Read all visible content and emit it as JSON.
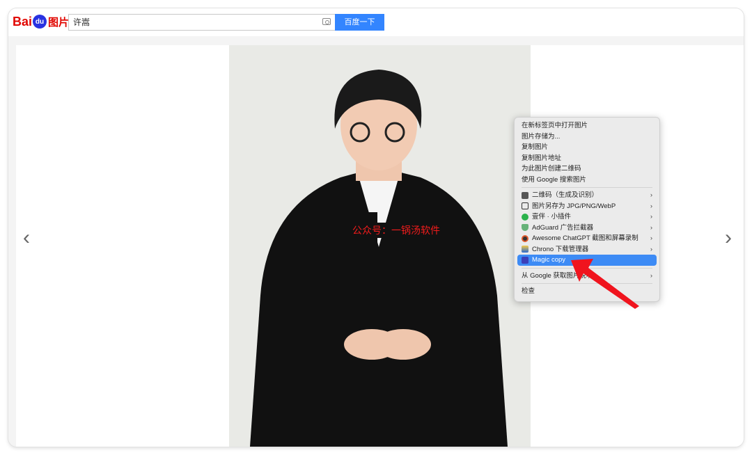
{
  "header": {
    "logo_text": "Bai du 图片",
    "search_value": "许嵩",
    "search_button": "百度一下"
  },
  "viewer": {
    "prev_icon": "chevron-left",
    "next_icon": "chevron-right",
    "watermark": "公众号：一锅汤软件"
  },
  "context_menu": {
    "group1": [
      "在新标签页中打开图片",
      "图片存储为...",
      "复制图片",
      "复制图片地址",
      "为此图片创建二维码",
      "使用 Google 搜索图片"
    ],
    "group2": [
      {
        "label": "二维码（生成及识别）",
        "icon": "qr-icon",
        "color": "#555555"
      },
      {
        "label": "图片另存为 JPG/PNG/WebP",
        "icon": "image-icon",
        "color": "#333333"
      },
      {
        "label": "壹伴 · 小插件",
        "icon": "yiban-icon",
        "color": "#2bb24c"
      },
      {
        "label": "AdGuard 广告拦截器",
        "icon": "shield-icon",
        "color": "#67b279"
      },
      {
        "label": "Awesome ChatGPT 截图和屏幕录制",
        "icon": "camera-lens-icon",
        "color": "#e05a2c"
      },
      {
        "label": "Chrono 下载管理器",
        "icon": "download-icon",
        "color": "#2b6bd1"
      },
      {
        "label": "Magic copy",
        "icon": "magic-copy-icon",
        "color": "#3b3fb8",
        "highlighted": true
      }
    ],
    "group3": [
      "从 Google 获取图片说明"
    ],
    "group4": [
      "检查"
    ]
  },
  "colors": {
    "accent": "#3385ff",
    "menu_highlight": "#3d8bf5",
    "arrow": "#f0141e"
  }
}
